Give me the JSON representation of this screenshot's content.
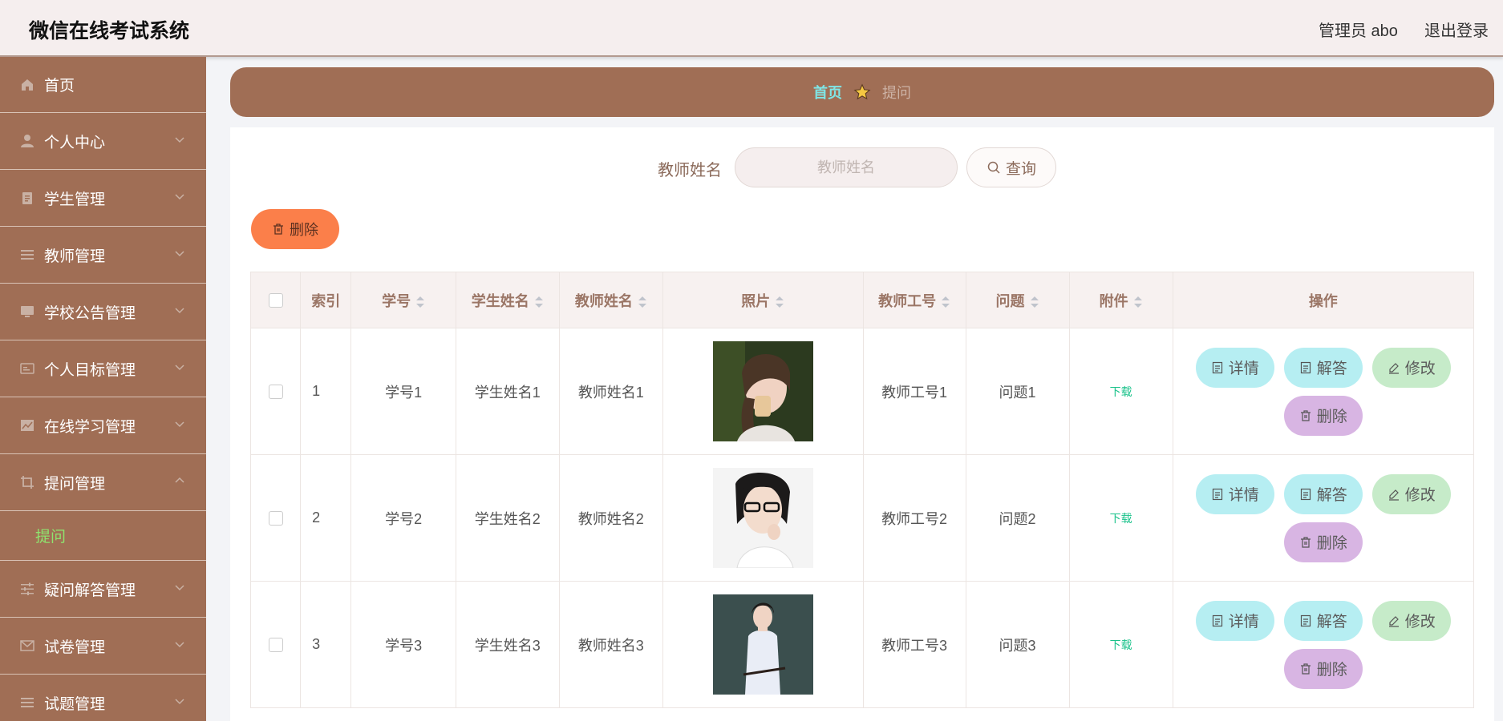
{
  "header": {
    "title": "微信在线考试系统",
    "user_label": "管理员 abo",
    "logout_label": "退出登录"
  },
  "sidebar": {
    "items": [
      {
        "label": "首页",
        "icon": "home-icon",
        "expandable": false
      },
      {
        "label": "个人中心",
        "icon": "person-icon",
        "expandable": true
      },
      {
        "label": "学生管理",
        "icon": "clipboard-icon",
        "expandable": true
      },
      {
        "label": "教师管理",
        "icon": "list-icon",
        "expandable": true
      },
      {
        "label": "学校公告管理",
        "icon": "monitor-icon",
        "expandable": true
      },
      {
        "label": "个人目标管理",
        "icon": "id-card-icon",
        "expandable": true
      },
      {
        "label": "在线学习管理",
        "icon": "chart-icon",
        "expandable": true
      },
      {
        "label": "提问管理",
        "icon": "crop-icon",
        "expandable": true,
        "expanded": true
      },
      {
        "label": "疑问解答管理",
        "icon": "sliders-icon",
        "expandable": true
      },
      {
        "label": "试卷管理",
        "icon": "mail-icon",
        "expandable": true
      },
      {
        "label": "试题管理",
        "icon": "menu-icon",
        "expandable": true
      }
    ],
    "sub_item": "提问",
    "colors": {
      "bg": "#a06e55",
      "active_sub": "#8fe36e"
    }
  },
  "breadcrumb": {
    "home": "首页",
    "current": "提问"
  },
  "search": {
    "label": "教师姓名",
    "placeholder": "教师姓名",
    "value": "",
    "button": "查询"
  },
  "toolbar": {
    "delete_label": "删除"
  },
  "table": {
    "columns": [
      "索引",
      "学号",
      "学生姓名",
      "教师姓名",
      "照片",
      "教师工号",
      "问题",
      "附件",
      "操作"
    ],
    "rows": [
      {
        "index": "1",
        "student_no": "学号1",
        "student_name": "学生姓名1",
        "teacher_name": "教师姓名1",
        "teacher_no": "教师工号1",
        "question": "问题1",
        "attachment": "下载"
      },
      {
        "index": "2",
        "student_no": "学号2",
        "student_name": "学生姓名2",
        "teacher_name": "教师姓名2",
        "teacher_no": "教师工号2",
        "question": "问题2",
        "attachment": "下载"
      },
      {
        "index": "3",
        "student_no": "学号3",
        "student_name": "学生姓名3",
        "teacher_name": "教师姓名3",
        "teacher_no": "教师工号3",
        "question": "问题3",
        "attachment": "下载"
      }
    ],
    "actions": {
      "detail": "详情",
      "answer": "解答",
      "edit": "修改",
      "delete": "删除"
    }
  }
}
